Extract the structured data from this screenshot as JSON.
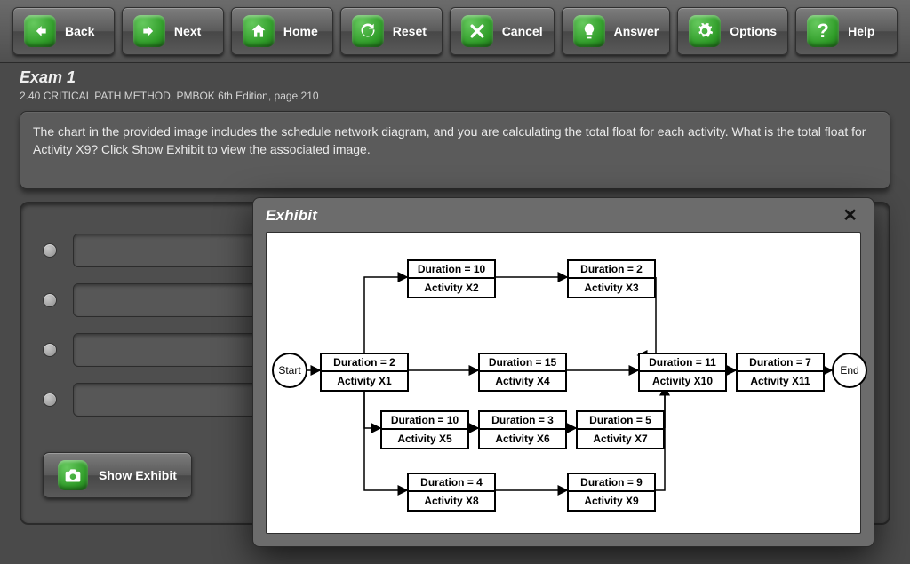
{
  "toolbar": {
    "back": "Back",
    "next": "Next",
    "home": "Home",
    "reset": "Reset",
    "cancel": "Cancel",
    "answer": "Answer",
    "options": "Options",
    "help": "Help"
  },
  "exam": {
    "title": "Exam 1",
    "subtitle": "2.40 CRITICAL PATH METHOD, PMBOK 6th Edition, page 210",
    "prompt": "The chart in the provided image includes the schedule network diagram, and you are calculating the total float for each activity. What is the total float for Activity X9? Click Show Exhibit to view the associated image."
  },
  "answers": {
    "options": [
      "",
      "",
      "",
      ""
    ]
  },
  "buttons": {
    "show_exhibit": "Show Exhibit"
  },
  "modal": {
    "title": "Exhibit",
    "close": "✕"
  },
  "diagram": {
    "start": "Start",
    "end": "End",
    "activities": {
      "x1": {
        "duration": "Duration = 2",
        "name": "Activity X1"
      },
      "x2": {
        "duration": "Duration = 10",
        "name": "Activity X2"
      },
      "x3": {
        "duration": "Duration = 2",
        "name": "Activity X3"
      },
      "x4": {
        "duration": "Duration = 15",
        "name": "Activity X4"
      },
      "x5": {
        "duration": "Duration = 10",
        "name": "Activity X5"
      },
      "x6": {
        "duration": "Duration = 3",
        "name": "Activity X6"
      },
      "x7": {
        "duration": "Duration = 5",
        "name": "Activity X7"
      },
      "x8": {
        "duration": "Duration = 4",
        "name": "Activity X8"
      },
      "x9": {
        "duration": "Duration = 9",
        "name": "Activity X9"
      },
      "x10": {
        "duration": "Duration = 11",
        "name": "Activity X10"
      },
      "x11": {
        "duration": "Duration = 7",
        "name": "Activity X11"
      }
    }
  },
  "chart_data": {
    "type": "network-diagram",
    "title": "Schedule Network Diagram",
    "nodes": [
      {
        "id": "Start",
        "type": "terminal"
      },
      {
        "id": "X1",
        "duration": 2
      },
      {
        "id": "X2",
        "duration": 10
      },
      {
        "id": "X3",
        "duration": 2
      },
      {
        "id": "X4",
        "duration": 15
      },
      {
        "id": "X5",
        "duration": 10
      },
      {
        "id": "X6",
        "duration": 3
      },
      {
        "id": "X7",
        "duration": 5
      },
      {
        "id": "X8",
        "duration": 4
      },
      {
        "id": "X9",
        "duration": 9
      },
      {
        "id": "X10",
        "duration": 11
      },
      {
        "id": "X11",
        "duration": 7
      },
      {
        "id": "End",
        "type": "terminal"
      }
    ],
    "edges": [
      [
        "Start",
        "X1"
      ],
      [
        "X1",
        "X2"
      ],
      [
        "X2",
        "X3"
      ],
      [
        "X3",
        "X10"
      ],
      [
        "X1",
        "X4"
      ],
      [
        "X4",
        "X10"
      ],
      [
        "X1",
        "X5"
      ],
      [
        "X5",
        "X6"
      ],
      [
        "X6",
        "X7"
      ],
      [
        "X7",
        "X10"
      ],
      [
        "X1",
        "X8"
      ],
      [
        "X8",
        "X9"
      ],
      [
        "X9",
        "X10"
      ],
      [
        "X10",
        "X11"
      ],
      [
        "X11",
        "End"
      ]
    ]
  }
}
